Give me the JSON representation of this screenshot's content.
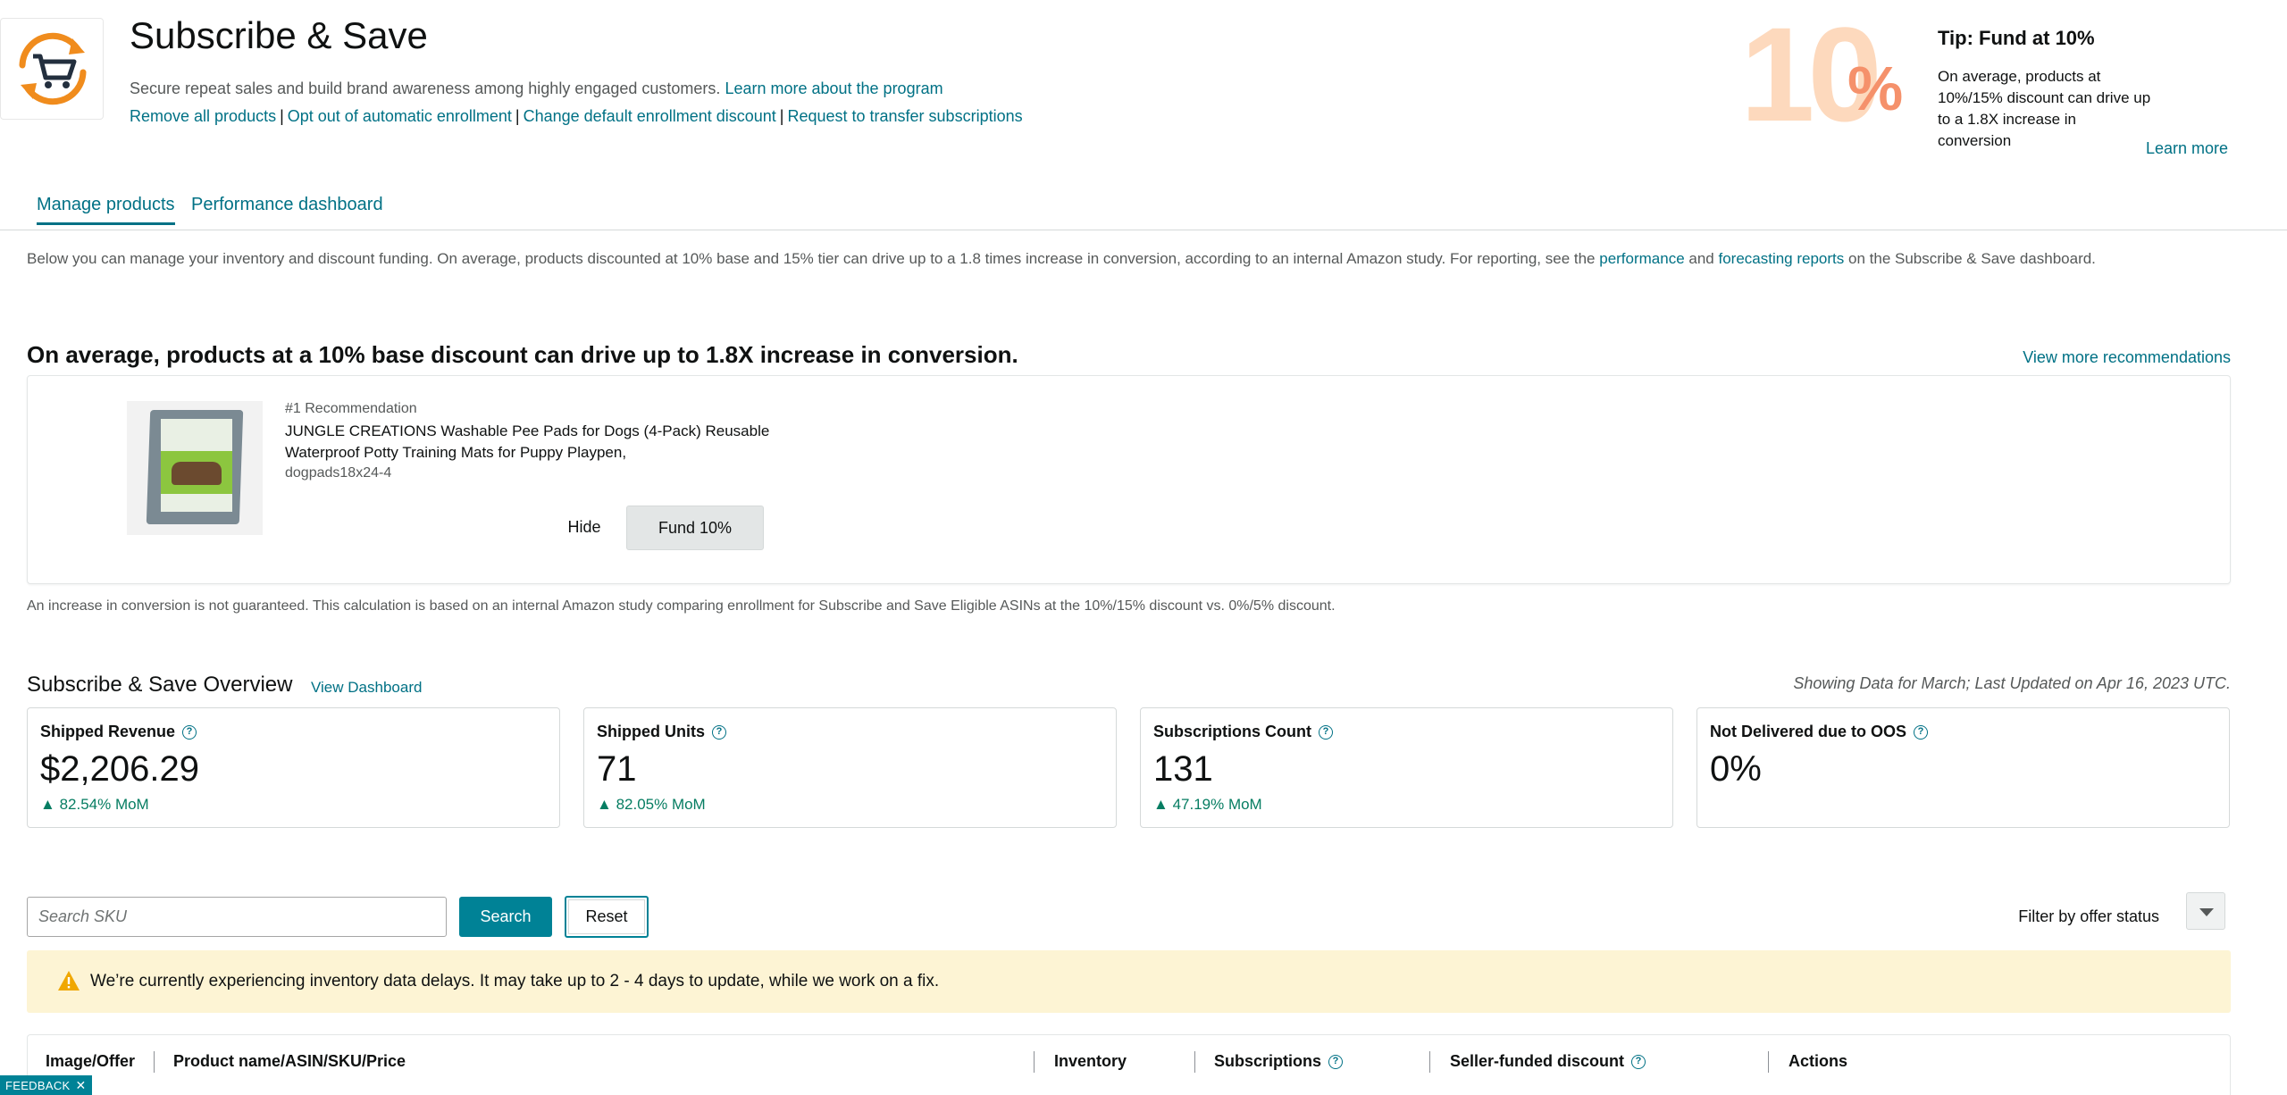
{
  "header": {
    "title": "Subscribe & Save",
    "subtitle": "Secure repeat sales and build brand awareness among highly engaged customers.",
    "learn_program": "Learn more about the program",
    "links": [
      "Remove all products",
      "Opt out of automatic enrollment",
      "Change default enrollment discount",
      "Request to transfer subscriptions"
    ],
    "separator": "|"
  },
  "tip": {
    "big_number": "10",
    "big_percent": "%",
    "title": "Tip: Fund at 10%",
    "text": "On average, products at 10%/15% discount can drive up to a 1.8X increase in conversion",
    "learn_more": "Learn more"
  },
  "tabs": [
    {
      "label": "Manage products",
      "active": true
    },
    {
      "label": "Performance dashboard",
      "active": false
    }
  ],
  "intro": {
    "text_1": "Below you can manage your inventory and discount funding. On average, products discounted at 10% base and 15% tier can drive up to a 1.8 times increase in conversion, according to an internal Amazon study. For reporting, see the ",
    "link_performance": "performance",
    "text_and": " and ",
    "link_forecasting": "forecasting reports",
    "text_2": " on the Subscribe & Save dashboard."
  },
  "recommendation": {
    "heading": "On average, products at a 10% base discount can drive up to 1.8X increase in conversion.",
    "view_more": "View more recommendations",
    "rank": "#1 Recommendation",
    "product_name": "JUNGLE CREATIONS Washable Pee Pads for Dogs (4-Pack) Reusable Waterproof Potty Training Mats for Puppy Playpen,",
    "sku": "dogpads18x24-4",
    "hide_label": "Hide",
    "fund_label": "Fund 10%"
  },
  "disclaimer": "An increase in conversion is not guaranteed. This calculation is based on an internal Amazon study comparing enrollment for Subscribe and Save Eligible ASINs at the 10%/15% discount vs. 0%/5% discount.",
  "overview": {
    "title": "Subscribe & Save Overview",
    "view_dashboard": "View Dashboard",
    "date_note": "Showing Data for March; Last Updated on Apr 16, 2023 UTC.",
    "metrics": [
      {
        "label": "Shipped Revenue",
        "value": "$2,206.29",
        "change": "82.54% MoM"
      },
      {
        "label": "Shipped Units",
        "value": "71",
        "change": "82.05% MoM"
      },
      {
        "label": "Subscriptions Count",
        "value": "131",
        "change": "47.19% MoM"
      },
      {
        "label": "Not Delivered due to OOS",
        "value": "0%",
        "change": ""
      }
    ]
  },
  "search": {
    "placeholder": "Search SKU",
    "search_label": "Search",
    "reset_label": "Reset",
    "filter_label": "Filter by offer status"
  },
  "alert": {
    "message": "We’re currently experiencing inventory data delays. It may take up to 2 - 4 days to update, while we work on a fix."
  },
  "table": {
    "columns": [
      "Image/Offer",
      "Product name/ASIN/SKU/Price",
      "Inventory",
      "Subscriptions",
      "Seller-funded discount",
      "Actions"
    ]
  },
  "feedback": {
    "label": "FEEDBACK",
    "close": "✕"
  },
  "colors": {
    "accent": "#007185",
    "button_teal": "#008296",
    "positive": "#067d62",
    "alert_bg": "#fdf4d4",
    "tip_light": "#fdd9bd",
    "tip_dark": "#f5916b"
  }
}
